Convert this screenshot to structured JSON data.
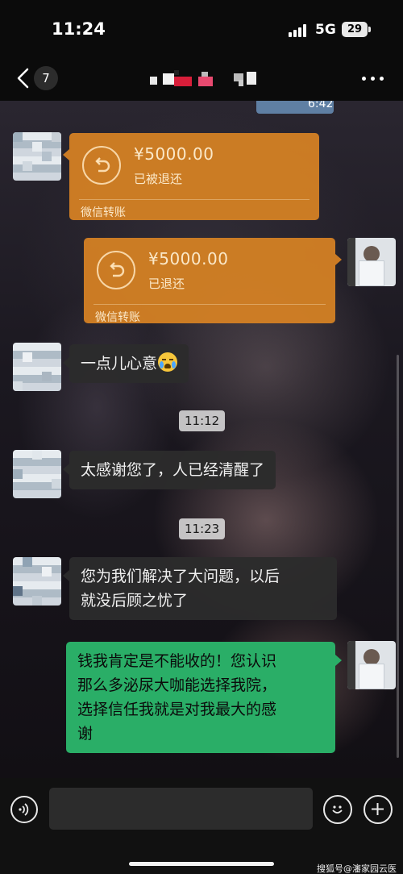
{
  "status_bar": {
    "time": "11:24",
    "network": "5G",
    "battery": "29"
  },
  "nav": {
    "back_icon": "chevron-left-icon",
    "unread_count": "7",
    "more_icon": "ellipsis-icon"
  },
  "messages": {
    "partial_time": "6:42",
    "transfer_1": {
      "amount": "¥5000.00",
      "status": "已被退还",
      "label": "微信转账"
    },
    "transfer_2": {
      "amount": "¥5000.00",
      "status": "已退还",
      "label": "微信转账"
    },
    "msg_1": "一点儿心意",
    "time_1": "11:12",
    "msg_2": "太感谢您了，人已经清醒了",
    "time_2": "11:23",
    "msg_3_line1": "您为我们解决了大问题，以后",
    "msg_3_line2": "就没后顾之忧了",
    "msg_4_line1": "钱我肯定是不能收的！您认识",
    "msg_4_line2": "那么多泌尿大咖能选择我院，",
    "msg_4_line3": "选择信任我就是对我最大的感",
    "msg_4_line4": "谢"
  },
  "input": {
    "placeholder": "",
    "voice_icon": "voice-icon",
    "emoji_icon": "emoji-icon",
    "plus_icon": "plus-icon"
  },
  "watermark": "搜狐号@瀋家园云医",
  "colors": {
    "transfer_bg": "#d48124",
    "sent_bubble": "#2aae67",
    "received_bubble": "#2c2c2c"
  }
}
